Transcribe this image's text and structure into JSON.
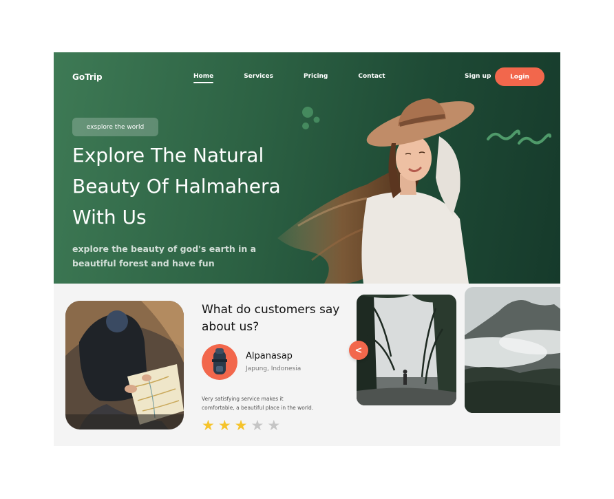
{
  "header": {
    "logo": "GoTrip",
    "nav": [
      "Home",
      "Services",
      "Pricing",
      "Contact"
    ],
    "signup_label": "Sign up",
    "login_label": "Login"
  },
  "hero": {
    "badge": "exsplore the world",
    "headline_lines": [
      "Explore The Natural",
      "Beauty Of Halmahera",
      "With Us"
    ],
    "subtext_lines": [
      "explore the beauty of god's earth in a",
      "beautiful forest and have fun"
    ]
  },
  "testimonial": {
    "title_lines": [
      "What do customers say",
      "about us?"
    ],
    "reviewer_name": "Alpanasap",
    "reviewer_location": "Japung, Indonesia",
    "review_lines": [
      "Very satisfying service makes it",
      "comfortable, a beautiful place in the world."
    ],
    "rating": 3,
    "rating_max": 5,
    "prev_icon": "<"
  },
  "colors": {
    "hero_green": "#2c6143",
    "accent_orange": "#f2674c",
    "star_gold": "#f5c32b",
    "section_bg": "#f4f4f4"
  },
  "icons": [
    "chevron-left-icon",
    "star-icon"
  ]
}
